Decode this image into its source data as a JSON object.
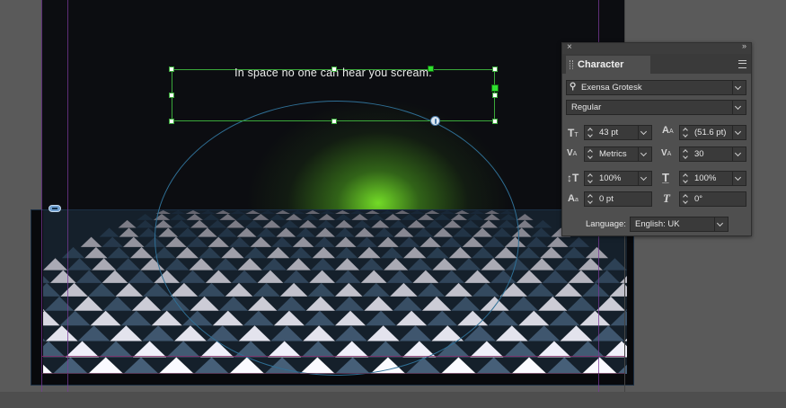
{
  "canvas": {
    "headline_text": "In space no one can hear you scream."
  },
  "character_panel": {
    "title": "Character",
    "close_glyph": "×",
    "collapse_glyph": "»",
    "font_family": "Exensa Grotesk",
    "font_style": "Regular",
    "font_size": "43 pt",
    "leading": "(51.6 pt)",
    "kerning": "Metrics",
    "tracking": "30",
    "vertical_scale": "100%",
    "horizontal_scale": "100%",
    "baseline_shift": "0 pt",
    "skew": "0°",
    "language_label": "Language:",
    "language": "English: UK"
  },
  "colors": {
    "glow": "#7ee62a",
    "selection": "#3aa83a",
    "panel_bg": "#4f4f4f",
    "pasteboard": "#5a5a5a"
  },
  "icons": [
    "search-icon",
    "font-size-icon",
    "leading-icon",
    "kerning-icon",
    "tracking-icon",
    "vertical-scale-icon",
    "horizontal-scale-icon",
    "baseline-shift-icon",
    "skew-icon",
    "panel-menu-icon",
    "link-icon"
  ]
}
